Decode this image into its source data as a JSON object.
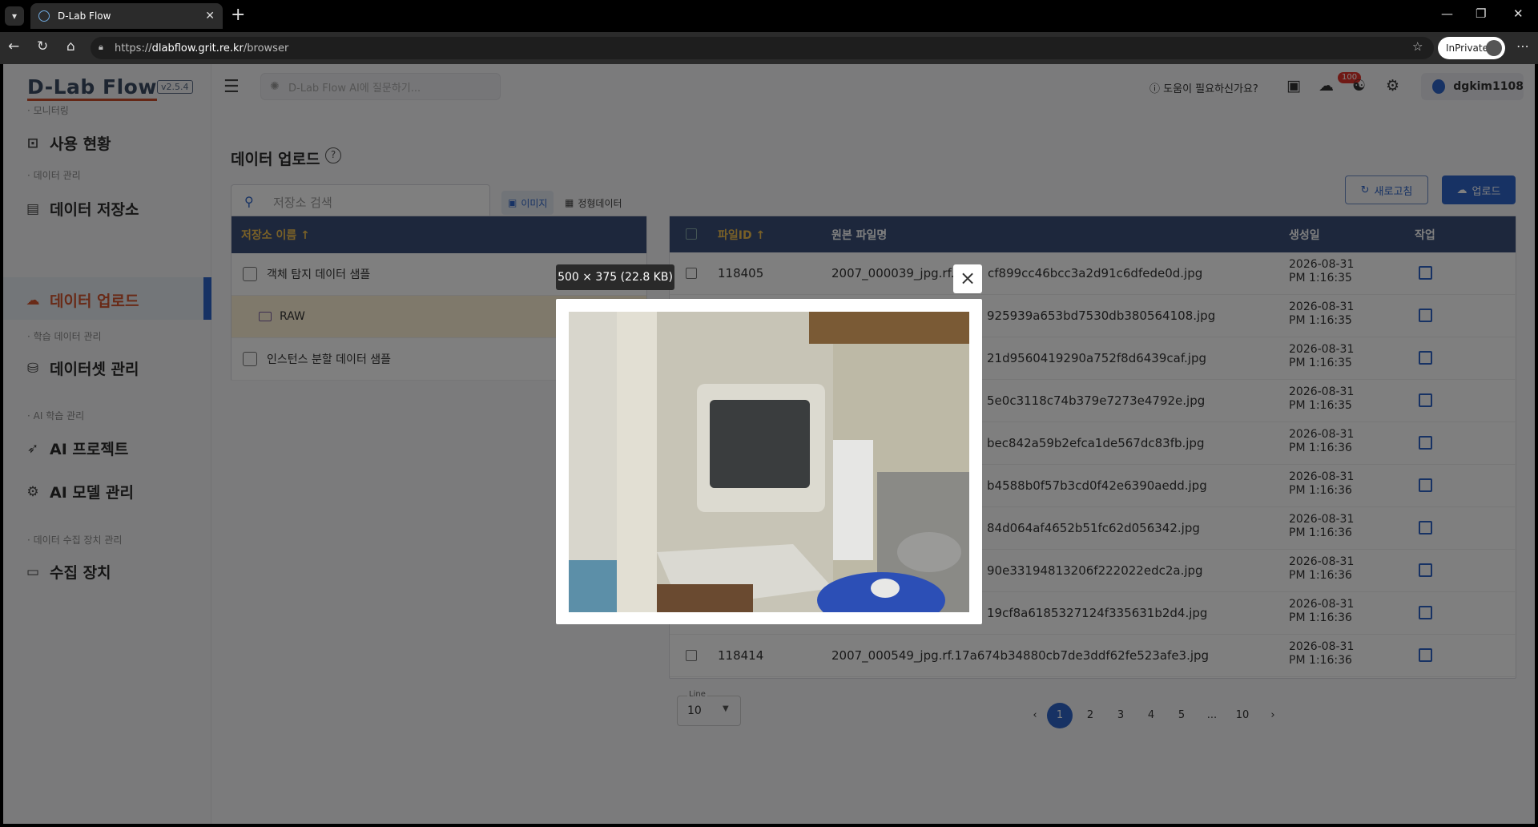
{
  "browser": {
    "tab_title": "D-Lab Flow",
    "url_prefix": "https://",
    "url_host": "dlabflow.grit.re.kr",
    "url_path": "/browser",
    "inprivate": "InPrivate"
  },
  "app": {
    "logo": "D-Lab Flow",
    "version": "v2.5.4",
    "ai_search_placeholder": "D-Lab Flow AI에 질문하기...",
    "help_text": "도움이 필요하신가요?",
    "notification_count": "100",
    "username": "dgkim1108"
  },
  "sidebar": {
    "sections": [
      {
        "title": "· 모니터링",
        "items": [
          "사용 현황"
        ]
      },
      {
        "title": "· 데이터 관리",
        "items": [
          "데이터 저장소",
          "데이터 업로드"
        ]
      },
      {
        "title": "· 학습 데이터 관리",
        "items": [
          "데이터셋 관리"
        ]
      },
      {
        "title": "· AI 학습 관리",
        "items": [
          "AI 프로젝트",
          "AI 모델 관리"
        ]
      },
      {
        "title": "· 데이터 수집 장치 관리",
        "items": [
          "수집 장치"
        ]
      }
    ],
    "active_item": "데이터 업로드"
  },
  "page": {
    "title": "데이터 업로드",
    "store_search_placeholder": "저장소 검색",
    "type_tabs": [
      "이미지",
      "정형데이터"
    ],
    "selected_type": "이미지",
    "refresh_label": "새로고침",
    "upload_label": "업로드"
  },
  "store_table": {
    "header": "저장소 이름 ↑",
    "rows": [
      {
        "name": "객체 탐지 데이터 샘플",
        "level": 0
      },
      {
        "name": "RAW",
        "level": 1
      },
      {
        "name": "인스턴스 분할 데이터 샘플",
        "level": 0
      }
    ]
  },
  "file_table": {
    "headers": {
      "id": "파일ID ↑",
      "name": "원본 파일명",
      "date": "생성일",
      "action": "작업"
    },
    "rows": [
      {
        "id": "118405",
        "name": "2007_000039_jpg.rf.e",
        "name_tail": "cf899cc46bcc3a2d91c6dfede0d.jpg",
        "date": "2026-08-31",
        "time": "PM 1:16:35"
      },
      {
        "id": "",
        "name": "",
        "name_tail": "925939a653bd7530db380564108.jpg",
        "date": "2026-08-31",
        "time": "PM 1:16:35"
      },
      {
        "id": "",
        "name": "",
        "name_tail": "21d9560419290a752f8d6439caf.jpg",
        "date": "2026-08-31",
        "time": "PM 1:16:35"
      },
      {
        "id": "",
        "name": "",
        "name_tail": "5e0c3118c74b379e7273e4792e.jpg",
        "date": "2026-08-31",
        "time": "PM 1:16:35"
      },
      {
        "id": "",
        "name": "",
        "name_tail": "bec842a59b2efca1de567dc83fb.jpg",
        "date": "2026-08-31",
        "time": "PM 1:16:36"
      },
      {
        "id": "",
        "name": "",
        "name_tail": "b4588b0f57b3cd0f42e6390aedd.jpg",
        "date": "2026-08-31",
        "time": "PM 1:16:36"
      },
      {
        "id": "",
        "name": "",
        "name_tail": "84d064af4652b51fc62d056342.jpg",
        "date": "2026-08-31",
        "time": "PM 1:16:36"
      },
      {
        "id": "",
        "name": "",
        "name_tail": "90e33194813206f222022edc2a.jpg",
        "date": "2026-08-31",
        "time": "PM 1:16:36"
      },
      {
        "id": "",
        "name": "",
        "name_tail": "19cf8a6185327124f335631b2d4.jpg",
        "date": "2026-08-31",
        "time": "PM 1:16:36"
      },
      {
        "id": "118414",
        "name": "2007_000549_jpg.rf.17a674b34880cb7de3ddf62fe523afe3.jpg",
        "name_tail": "",
        "date": "2026-08-31",
        "time": "PM 1:16:36"
      }
    ]
  },
  "pagination": {
    "line_label": "Line",
    "line_value": "10",
    "pages": [
      "1",
      "2",
      "3",
      "4",
      "5",
      "...",
      "10"
    ],
    "current": "1"
  },
  "preview": {
    "info": "500 × 375 (22.8 KB)",
    "close": "×"
  }
}
